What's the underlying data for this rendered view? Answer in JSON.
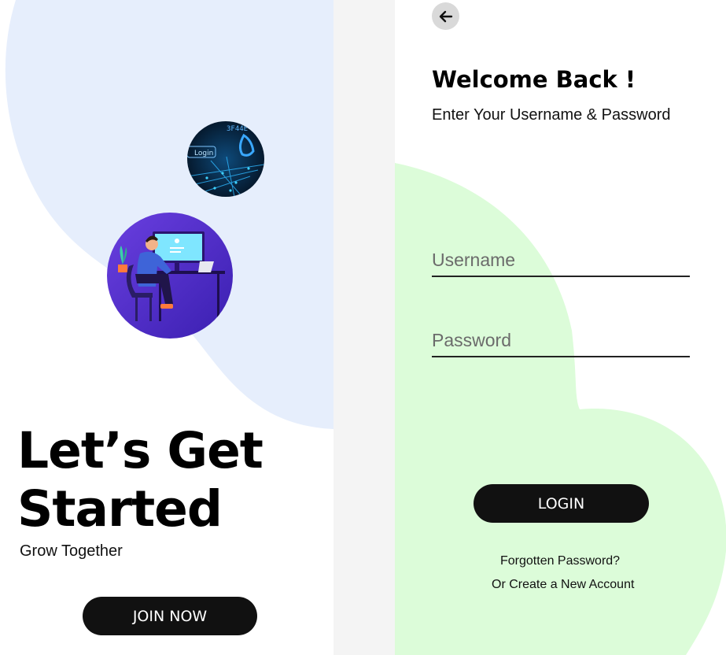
{
  "left_panel": {
    "title_line1": "Let’s Get",
    "title_line2": "Started",
    "subtitle": "Grow Together",
    "join_button_label": "JOIN NOW",
    "small_image_label": "Login",
    "small_image_code": "3F44E",
    "colors": {
      "blob": "#e6eefc",
      "button": "#111111"
    }
  },
  "right_panel": {
    "back_icon": "arrow-left-icon",
    "heading": "Welcome Back !",
    "instruction": "Enter Your Username & Password",
    "username_placeholder": "Username",
    "password_placeholder": "Password",
    "login_button_label": "LOGIN",
    "forgot_link": "Forgotten Password?",
    "create_link": "Or Create a New Account",
    "colors": {
      "blob": "#dcfcd9",
      "button": "#111111"
    }
  }
}
